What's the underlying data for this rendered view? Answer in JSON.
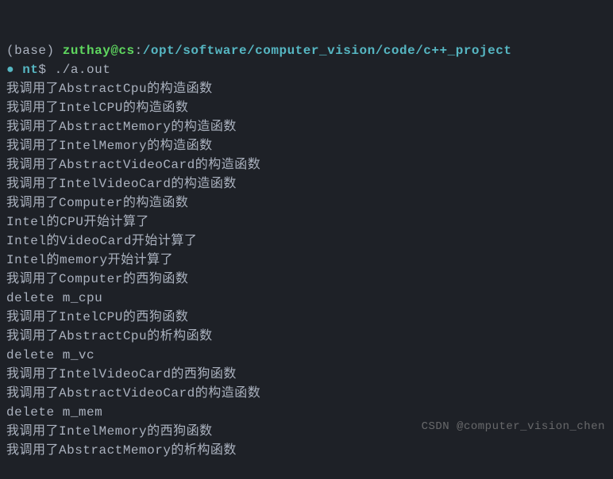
{
  "prompt": {
    "base": "(base) ",
    "user_host": "zuthay@cs",
    "colon": ":",
    "path": "/opt/software/computer_vision/code/c++_project",
    "path_continuation": "nt",
    "dollar": "$ ",
    "command": "./a.out"
  },
  "output_lines": [
    "我调用了AbstractCpu的构造函数",
    "我调用了IntelCPU的构造函数",
    "我调用了AbstractMemory的构造函数",
    "我调用了IntelMemory的构造函数",
    "我调用了AbstractVideoCard的构造函数",
    "我调用了IntelVideoCard的构造函数",
    "我调用了Computer的构造函数",
    "Intel的CPU开始计算了",
    "Intel的VideoCard开始计算了",
    "Intel的memory开始计算了",
    "我调用了Computer的西狗函数",
    "delete m_cpu",
    "我调用了IntelCPU的西狗函数",
    "我调用了AbstractCpu的析构函数",
    "delete m_vc",
    "我调用了IntelVideoCard的西狗函数",
    "我调用了AbstractVideoCard的构造函数",
    "delete m_mem",
    "我调用了IntelMemory的西狗函数",
    "我调用了AbstractMemory的析构函数"
  ],
  "watermark": "CSDN @computer_vision_chen"
}
